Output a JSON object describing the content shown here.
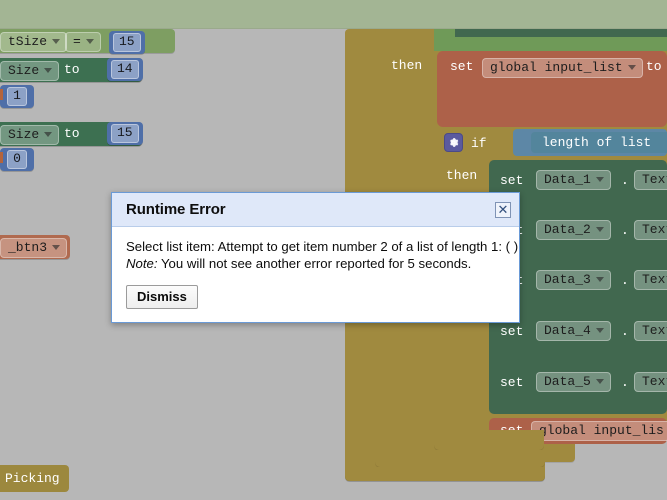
{
  "workspace": {
    "left_blocks": [
      {
        "field": "tSize",
        "op": "=",
        "value": "15",
        "kind": "comparison"
      },
      {
        "field": "Size",
        "op": "to",
        "value": "14",
        "kind": "setter"
      },
      {
        "value": "1",
        "kind": "number"
      },
      {
        "field": "Size",
        "op": "to",
        "value": "15",
        "kind": "setter"
      },
      {
        "value": "0",
        "kind": "number"
      },
      {
        "field": "_btn3",
        "kind": "component-getter"
      }
    ],
    "right_blocks": {
      "then_label_1": "then",
      "set_label": "set",
      "global_input_list": "global input_list",
      "to_label": "to",
      "if_label": "if",
      "then_label_2": "then",
      "length_of_list": "length of list",
      "dot": ".",
      "text_label": "Text",
      "data_rows": [
        {
          "set": "set",
          "component": "Data_1",
          "property": "Text"
        },
        {
          "set": "set",
          "component": "Data_2",
          "property": "Text"
        },
        {
          "set": "set",
          "component": "Data_3",
          "property": "Text"
        },
        {
          "set": "set",
          "component": "Data_4",
          "property": "Text"
        },
        {
          "set": "set",
          "component": "Data_5",
          "property": "Text"
        }
      ],
      "bottom_set": "set",
      "bottom_global": "global input_lis"
    },
    "picking_tab": "Picking"
  },
  "dialog": {
    "title": "Runtime Error",
    "close_icon": "close-icon",
    "message_line1": "Select list item: Attempt to get item number 2 of a list of length 1: ( )",
    "note_label": "Note:",
    "note_text": "You will not see another error reported for 5 seconds.",
    "dismiss_label": "Dismiss"
  },
  "colors": {
    "canvas": "#b7b7b7",
    "control_gold": "#a08a3f",
    "component_green": "#41684f",
    "variable_salmon": "#ad6149",
    "list_blue": "#5d87a6",
    "math_blue": "#4f6fa8",
    "logic_green": "#7e9e62",
    "dialog_header": "#dfe8f9",
    "dialog_border": "#6a9ad6"
  }
}
